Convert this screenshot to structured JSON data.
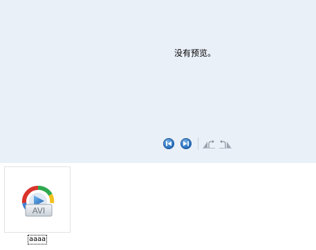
{
  "preview": {
    "message": "没有预览。"
  },
  "toolbar": {
    "buttons": [
      {
        "icon": "previous-icon"
      },
      {
        "icon": "next-icon"
      },
      {
        "icon": "rotate-left-icon"
      },
      {
        "icon": "rotate-right-icon"
      }
    ]
  },
  "file": {
    "name": "aaaa",
    "type_badge": "AVI",
    "icon": "avi-video-file-icon"
  },
  "colors": {
    "preview_background": "#eaf0f8",
    "nav_button": "#2c74c2"
  }
}
